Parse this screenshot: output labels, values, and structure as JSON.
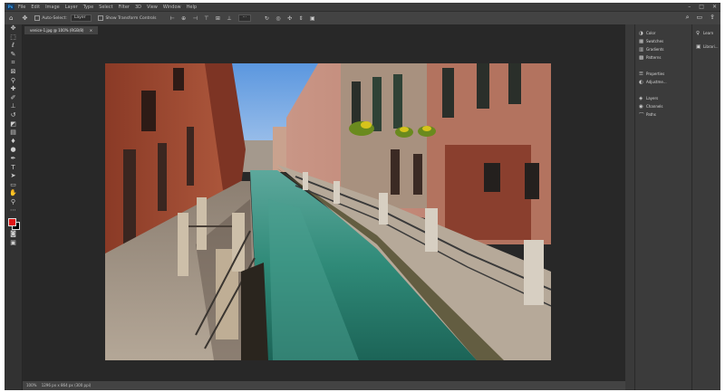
{
  "menubar": {
    "logo": "Ps",
    "items": [
      "File",
      "Edit",
      "Image",
      "Layer",
      "Type",
      "Select",
      "Filter",
      "3D",
      "View",
      "Window",
      "Help"
    ],
    "window_controls": [
      "–",
      "□",
      "✕"
    ]
  },
  "options": {
    "auto_select_label": "Auto-Select:",
    "layer_select": "Layer",
    "transform_label": "Show Transform Controls",
    "more": "···"
  },
  "document": {
    "tab_title": "venice-1.jpg @ 100% (RGB/8)",
    "close": "×"
  },
  "status": {
    "zoom": "100%",
    "doc_info": "1296 px x 864 px (300 ppi)"
  },
  "panels_left": [
    {
      "icon": "color-icon",
      "label": "Color"
    },
    {
      "icon": "swatches-icon",
      "label": "Swatches"
    },
    {
      "icon": "gradients-icon",
      "label": "Gradients"
    },
    {
      "icon": "patterns-icon",
      "label": "Patterns"
    },
    {
      "icon": "properties-icon",
      "label": "Properties"
    },
    {
      "icon": "adjustments-icon",
      "label": "Adjustme..."
    },
    {
      "icon": "layers-icon",
      "label": "Layers"
    },
    {
      "icon": "channels-icon",
      "label": "Channels"
    },
    {
      "icon": "paths-icon",
      "label": "Paths"
    }
  ],
  "panels_right": [
    {
      "icon": "learn-icon",
      "label": "Learn"
    },
    {
      "icon": "libraries-icon",
      "label": "Librari..."
    }
  ],
  "colors": {
    "foreground": "#e01616",
    "background": "#000000",
    "workspace": "#282828",
    "panel": "#3b3b3b"
  }
}
